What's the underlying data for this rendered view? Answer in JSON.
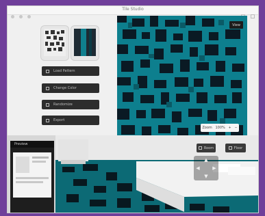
{
  "window": {
    "title": "Tile Studio"
  },
  "sidebar": {
    "buttons": [
      {
        "label": "Load Pattern",
        "icon": "folder-icon"
      },
      {
        "label": "Change Color",
        "icon": "palette-icon"
      },
      {
        "label": "Randomize",
        "icon": "shuffle-icon"
      },
      {
        "label": "Export",
        "icon": "export-icon"
      }
    ]
  },
  "pattern_panel": {
    "button_label": "View",
    "zoom_label": "Zoom",
    "zoom_value": "100%"
  },
  "room_view": {
    "preview_title": "Preview",
    "buttons": [
      {
        "label": "Room",
        "icon": "room-icon"
      },
      {
        "label": "Floor",
        "icon": "floor-icon"
      }
    ]
  },
  "colors": {
    "accent": "#0d7f8e",
    "dark_tile": "#0a1a24",
    "background": "#6f3f9a"
  }
}
